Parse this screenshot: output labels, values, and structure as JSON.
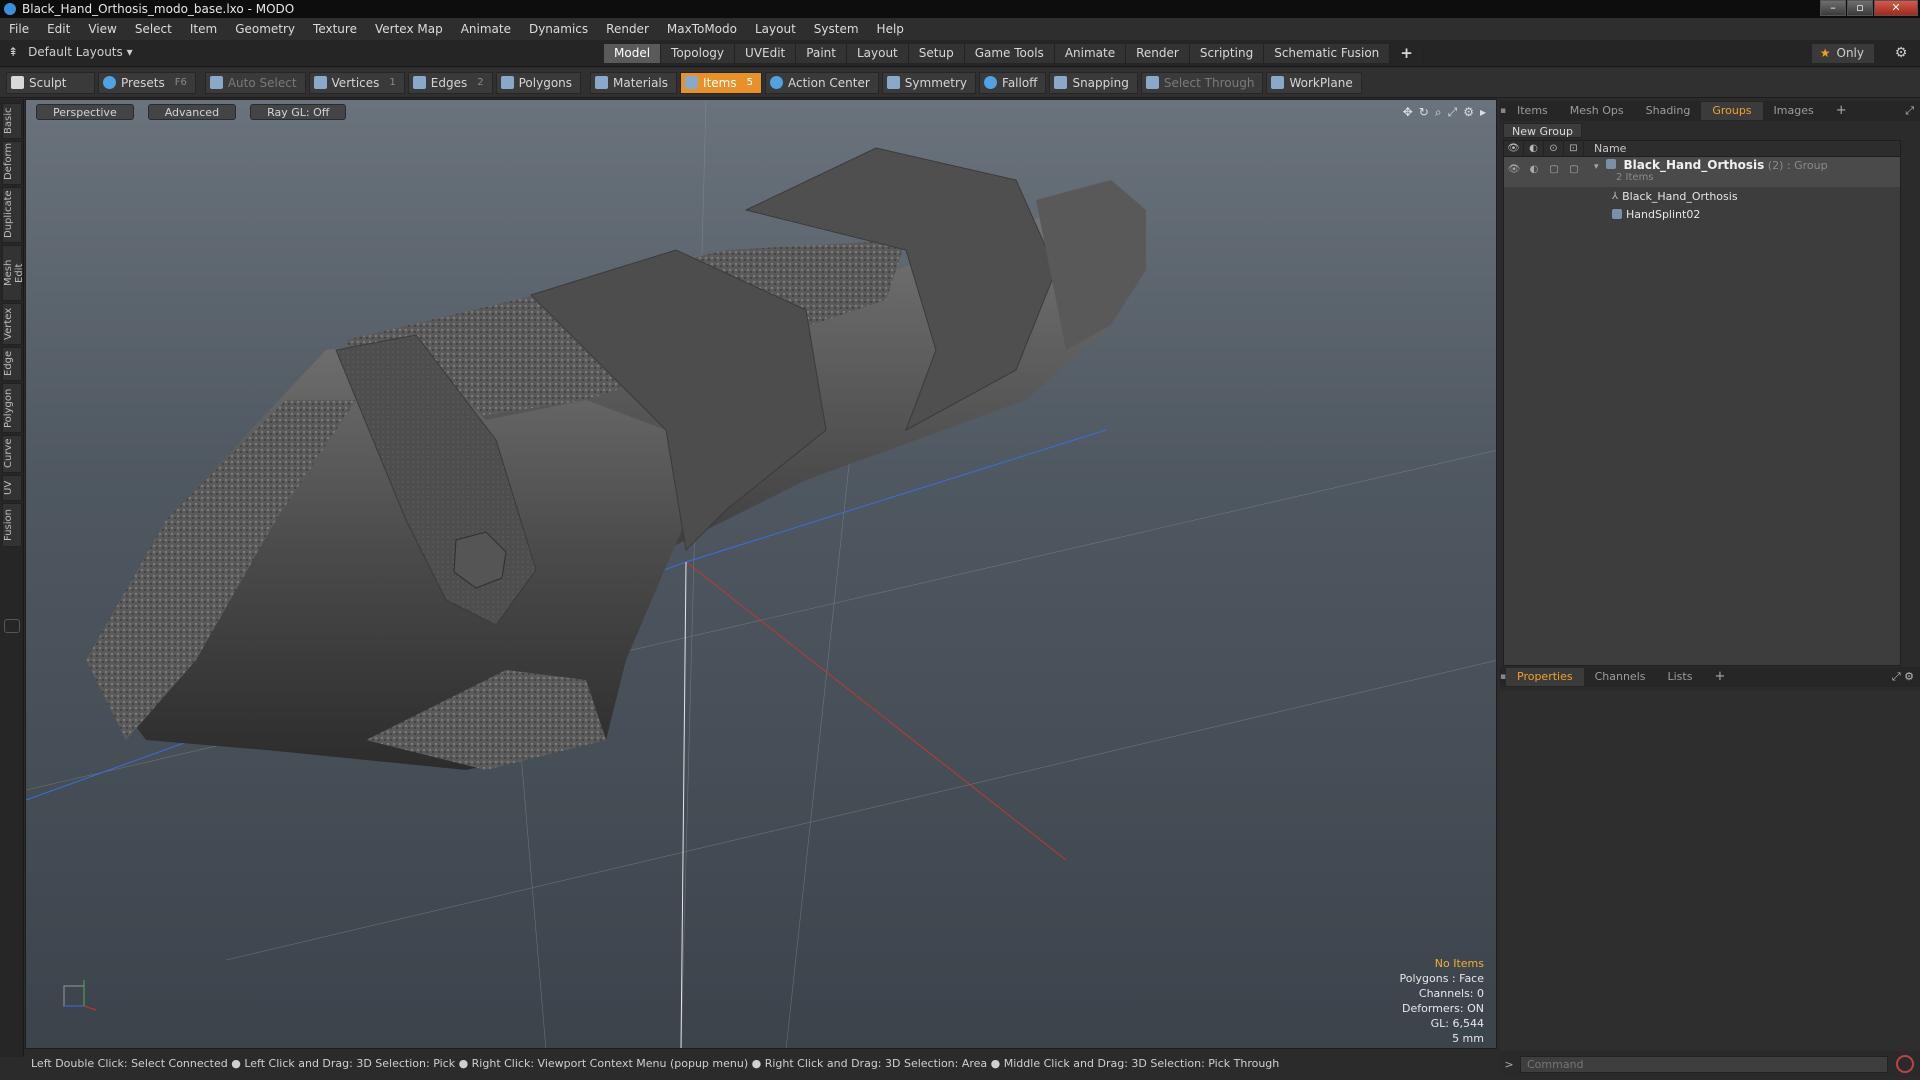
{
  "window": {
    "title": "Black_Hand_Orthosis_modo_base.lxo - MODO",
    "buttons": [
      "–",
      "▫",
      "✕"
    ]
  },
  "menu": [
    "File",
    "Edit",
    "View",
    "Select",
    "Item",
    "Geometry",
    "Texture",
    "Vertex Map",
    "Animate",
    "Dynamics",
    "Render",
    "MaxToModo",
    "Layout",
    "System",
    "Help"
  ],
  "layoutbar": {
    "layout_select": "Default Layouts ▾",
    "tabs": [
      "Model",
      "Topology",
      "UVEdit",
      "Paint",
      "Layout",
      "Setup",
      "Game Tools",
      "Animate",
      "Render",
      "Scripting",
      "Schematic Fusion"
    ],
    "active_tab": "Model",
    "only_label": "Only"
  },
  "toolbar": {
    "sculpt": "Sculpt",
    "presets": "Presets",
    "presets_key": "F6",
    "auto_select": "Auto Select",
    "vertices": "Vertices",
    "vertices_key": "1",
    "edges": "Edges",
    "edges_key": "2",
    "polygons": "Polygons",
    "materials": "Materials",
    "items": "Items",
    "items_key": "5",
    "action_center": "Action Center",
    "symmetry": "Symmetry",
    "falloff": "Falloff",
    "snapping": "Snapping",
    "select_through": "Select Through",
    "workplane": "WorkPlane"
  },
  "left_tabs": [
    "Basic",
    "Deform",
    "Duplicate",
    "Mesh Edit",
    "Vertex",
    "Edge",
    "Polygon",
    "Curve",
    "UV",
    "Fusion"
  ],
  "viewport": {
    "perspective": "Perspective",
    "advanced": "Advanced",
    "raygl": "Ray GL: Off",
    "info": {
      "no_items": "No Items",
      "polygons": "Polygons : Face",
      "channels": "Channels: 0",
      "deformers": "Deformers: ON",
      "gl": "GL: 6,544",
      "scale": "5 mm"
    }
  },
  "statusbar": "Left Double Click: Select Connected ● Left Click and Drag: 3D Selection: Pick ● Right Click: Viewport Context Menu (popup menu) ● Right Click and Drag: 3D Selection: Area ● Middle Click and Drag: 3D Selection: Pick Through",
  "groups_panel": {
    "tabs": [
      "Items",
      "Mesh Ops",
      "Shading",
      "Groups",
      "Images"
    ],
    "active_tab": "Groups",
    "new_group": "New Group",
    "name_header": "Name",
    "group": {
      "name": "Black_Hand_Orthosis",
      "suffix": "(2) : Group",
      "count": "2 Items",
      "children": [
        "Black_Hand_Orthosis",
        "HandSplint02"
      ]
    }
  },
  "properties_panel": {
    "tabs": [
      "Properties",
      "Channels",
      "Lists"
    ],
    "active_tab": "Properties"
  },
  "command": {
    "placeholder": "Command"
  }
}
